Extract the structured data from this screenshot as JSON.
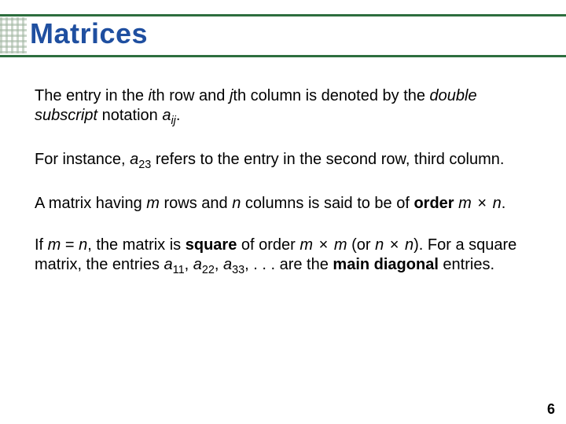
{
  "title": "Matrices",
  "page_number": "6",
  "p1": {
    "t1": "The entry in the ",
    "i1": "i",
    "t2": "th row and ",
    "i2": "j",
    "t3": "th column is denoted by the ",
    "i3": "double subscript",
    "t4": " notation ",
    "i4": "a",
    "sub1": "ij",
    "t5": "."
  },
  "p2": {
    "t1": "For instance, ",
    "i1": "a",
    "sub1": "23",
    "t2": " refers to the entry in the second row, third column."
  },
  "p3": {
    "t1": " A matrix having ",
    "i2": "m",
    "t2": " rows and ",
    "i3": "n",
    "t3": " columns is said to be of ",
    "b1": "order",
    "t4": " ",
    "i4": "m",
    "mult": " × ",
    "i5": "n",
    "t5": "."
  },
  "p4": {
    "t1": "If ",
    "i1": "m",
    "t2": " = ",
    "i2": "n",
    "t3": ", the matrix is ",
    "b1": "square",
    "t4": " of order ",
    "i3": "m",
    "mult": " × ",
    "i4": "m",
    "t5": " (or ",
    "i5": "n",
    "i6": "n",
    "t6": "). For a square matrix, the entries ",
    "i7": "a",
    "sub1": "11",
    "c": ", ",
    "i8": "a",
    "sub2": "22",
    "i9": "a",
    "sub3": "33",
    "t7": ", . . . are the ",
    "b2": "main diagonal",
    "t8": " entries."
  }
}
